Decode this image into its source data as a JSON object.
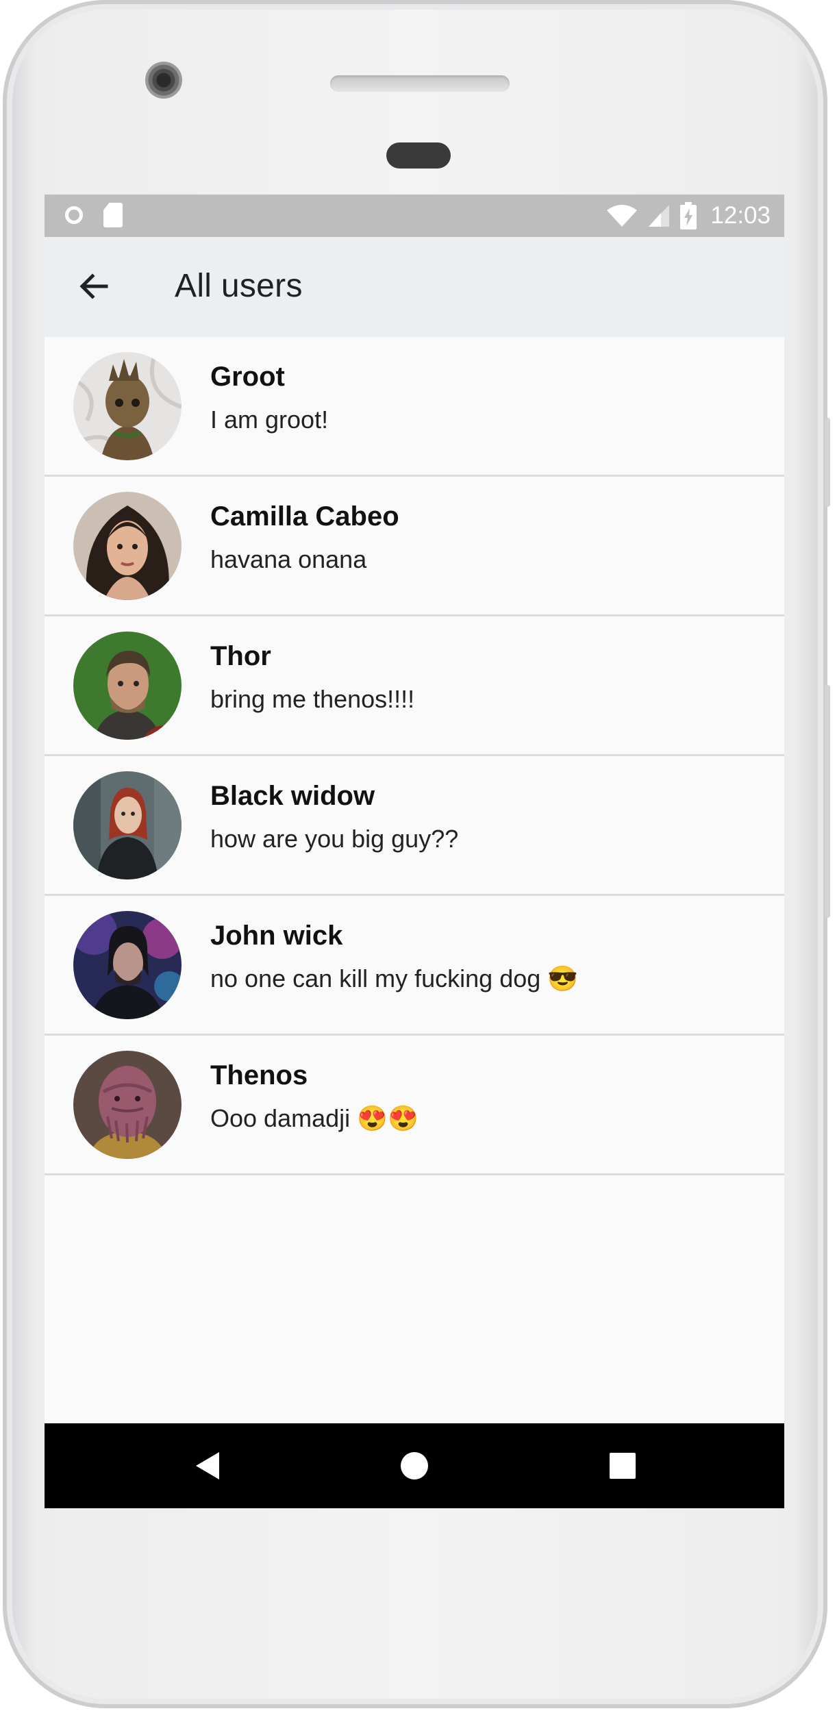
{
  "status_bar": {
    "time": "12:03",
    "left_icons": [
      "circle-icon",
      "sd-card-icon"
    ],
    "right_icons": [
      "wifi-icon",
      "cell-signal-icon",
      "battery-charging-icon"
    ]
  },
  "app_bar": {
    "title": "All users",
    "back_icon": "arrow-back-icon"
  },
  "users": [
    {
      "name": "Groot",
      "status": "I am groot!",
      "avatar": "groot-avatar"
    },
    {
      "name": "Camilla Cabeo",
      "status": "havana onana",
      "avatar": "camilla-avatar"
    },
    {
      "name": "Thor",
      "status": "bring me thenos!!!!",
      "avatar": "thor-avatar"
    },
    {
      "name": "Black widow",
      "status": "how are you big guy??",
      "avatar": "black-widow-avatar"
    },
    {
      "name": "John wick",
      "status": "no one can kill my fucking dog 😎",
      "avatar": "john-wick-avatar"
    },
    {
      "name": "Thenos",
      "status": "Ooo damadji 😍😍",
      "avatar": "thenos-avatar"
    }
  ],
  "nav_bar": {
    "icons": [
      "back-triangle-icon",
      "home-circle-icon",
      "recents-square-icon"
    ]
  },
  "colors": {
    "status_bar": "#bdbdbd",
    "app_bar": "#eceff1",
    "list_background": "#fafafa",
    "divider": "#dcdcdc",
    "nav_bar": "#000000"
  }
}
